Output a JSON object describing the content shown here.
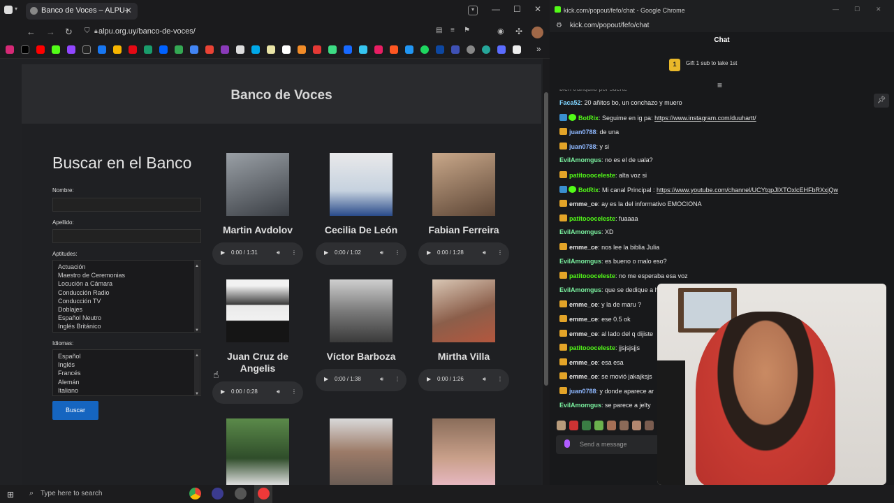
{
  "left_browser": {
    "tab_title": "Banco de Voces – ALPU",
    "url": "alpu.org.uy/banco-de-voces/",
    "page_title": "Banco de Voces",
    "search_heading": "Buscar en el Banco",
    "labels": {
      "nombre": "Nombre:",
      "apellido": "Apellido:",
      "aptitudes": "Aptitudes:",
      "idiomas": "Idiomas:"
    },
    "aptitudes": [
      "Actuación",
      "Maestro de Ceremonias",
      "Locución a Cámara",
      "Conducción Radio",
      "Conducción TV",
      "Doblajes",
      "Español Neutro",
      "Inglés Británico"
    ],
    "idiomas": [
      "Español",
      "Inglés",
      "Francés",
      "Alemán",
      "Italiano"
    ],
    "search_button": "Buscar",
    "voices": [
      {
        "name": "Martin Avdolov",
        "time": "0:00 / 1:31"
      },
      {
        "name": "Cecilia De León",
        "time": "0:00 / 1:02"
      },
      {
        "name": "Fabian Ferreira",
        "time": "0:00 / 1:28"
      },
      {
        "name": "Juan Cruz de Angelis",
        "time": "0:00 / 0:28"
      },
      {
        "name": "Víctor Barboza",
        "time": "0:00 / 1:38"
      },
      {
        "name": "Mirtha Villa",
        "time": "0:00 / 1:26"
      }
    ]
  },
  "right_chat": {
    "window_title": "kick.com/popout/fefo/chat - Google Chrome",
    "url": "kick.com/popout/fefo/chat",
    "header": "Chat",
    "gift_text": "Gift 1 sub to take 1st",
    "gift_badge": "1",
    "messages": [
      {
        "user": "Faca52",
        "text": "20 añitos bo, un conchazo y muero",
        "color": "#7fd4ff",
        "badge": "none"
      },
      {
        "user": "BotRix",
        "text": "Seguime en ig pa: ",
        "link": "https://www.instagram.com/duuhartt/",
        "color": "#53fc18",
        "badge": "bot"
      },
      {
        "user": "juan0788",
        "text": "de una",
        "color": "#8fb8ff",
        "badge": "crown"
      },
      {
        "user": "juan0788",
        "text": "y si",
        "color": "#8fb8ff",
        "badge": "crown"
      },
      {
        "user": "EvilAmomgus",
        "text": "no es el de uala?",
        "color": "#7bf2a0",
        "badge": "none"
      },
      {
        "user": "patitoooceleste",
        "text": "alta voz si",
        "color": "#53fc18",
        "badge": "crown"
      },
      {
        "user": "BotRix",
        "text": "Mi canal Principal : ",
        "link": "https://www.youtube.com/channel/UCYtqpJIXTOxlcEHFbRXxjQw",
        "color": "#53fc18",
        "badge": "bot"
      },
      {
        "user": "emme_ce",
        "text": "ay es la del informativo EMOCIONA",
        "color": "#e6e6e6",
        "badge": "crown"
      },
      {
        "user": "patitoooceleste",
        "text": "fuaaaa",
        "color": "#53fc18",
        "badge": "crown"
      },
      {
        "user": "EvilAmomgus",
        "text": "XD",
        "color": "#7bf2a0",
        "badge": "none"
      },
      {
        "user": "emme_ce",
        "text": "nos lee la biblia Julia",
        "color": "#e6e6e6",
        "badge": "crown"
      },
      {
        "user": "EvilAmomgus",
        "text": "es bueno o malo eso?",
        "color": "#7bf2a0",
        "badge": "none"
      },
      {
        "user": "patitoooceleste",
        "text": "no me esperaba esa voz",
        "color": "#53fc18",
        "badge": "crown"
      },
      {
        "user": "EvilAmomgus",
        "text": "que se dedique a h",
        "color": "#7bf2a0",
        "badge": "none"
      },
      {
        "user": "emme_ce",
        "text": "y la de maru ?",
        "color": "#e6e6e6",
        "badge": "crown"
      },
      {
        "user": "emme_ce",
        "text": "ese 0.5 ok",
        "color": "#e6e6e6",
        "badge": "crown"
      },
      {
        "user": "emme_ce",
        "text": "al lado del q dijiste",
        "color": "#e6e6e6",
        "badge": "crown"
      },
      {
        "user": "patitoooceleste",
        "text": "jjsjsjsjjs",
        "color": "#53fc18",
        "badge": "crown"
      },
      {
        "user": "emme_ce",
        "text": "esa esa",
        "color": "#e6e6e6",
        "badge": "crown"
      },
      {
        "user": "emme_ce",
        "text": "se movió jakajksjs",
        "color": "#e6e6e6",
        "badge": "crown"
      },
      {
        "user": "juan0788",
        "text": "y donde aparece ar",
        "color": "#8fb8ff",
        "badge": "crown"
      },
      {
        "user": "EvilAmomgus",
        "text": "se parece a jelty",
        "color": "#7bf2a0",
        "badge": "none"
      }
    ],
    "send_placeholder": "Send a message"
  },
  "taskbar": {
    "search_placeholder": "Type here to search"
  }
}
